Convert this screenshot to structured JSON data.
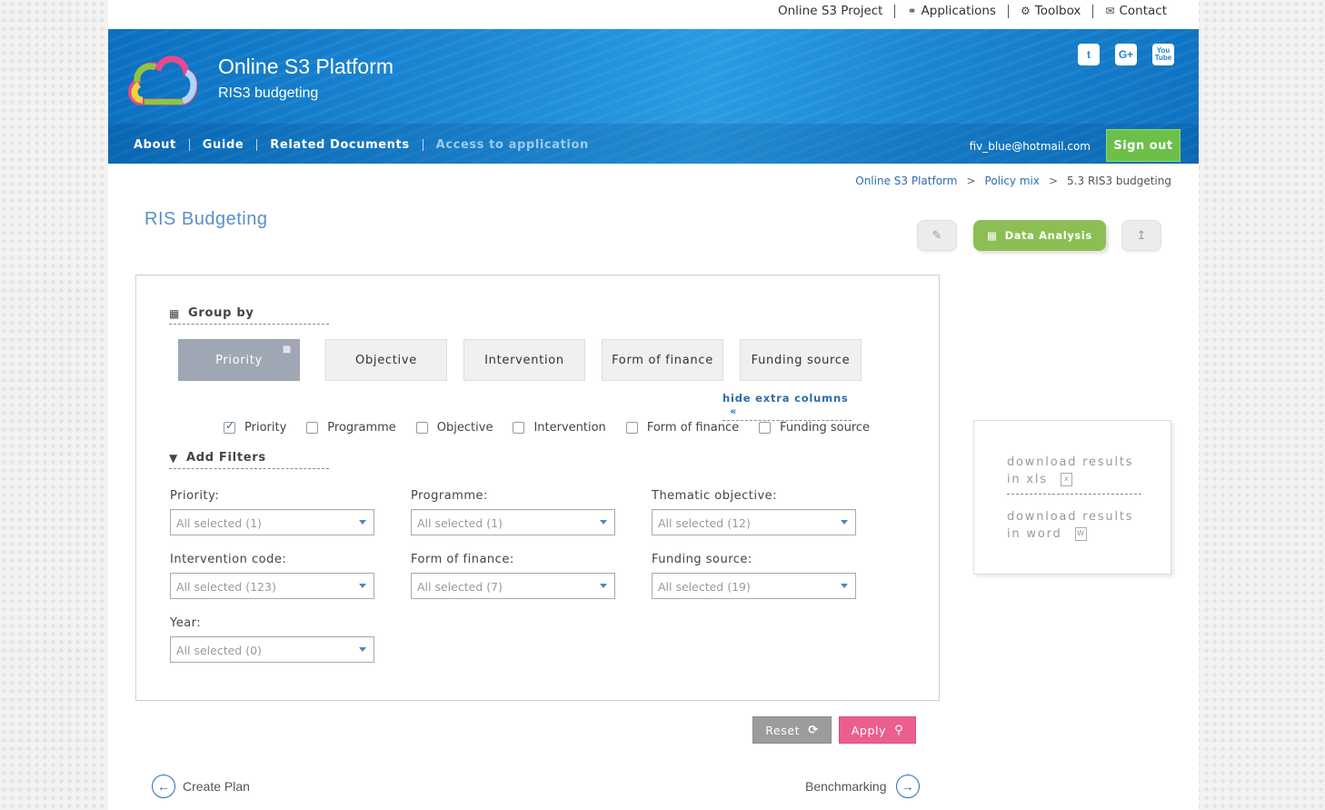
{
  "topnav": {
    "items": [
      {
        "label": "Online S3 Project",
        "icon": ""
      },
      {
        "label": "Applications",
        "icon": "bulb-icon"
      },
      {
        "label": "Toolbox",
        "icon": "gear-icon"
      },
      {
        "label": "Contact",
        "icon": "envelope-icon"
      }
    ]
  },
  "header": {
    "title": "Online S3 Platform",
    "subtitle": "RIS3 budgeting",
    "social": [
      "twitter-icon",
      "google-plus-icon",
      "youtube-icon"
    ],
    "nav": [
      {
        "label": "About"
      },
      {
        "label": "Guide"
      },
      {
        "label": "Related Documents"
      },
      {
        "label": "Access to application"
      }
    ],
    "user_email": "fiv_blue@hotmail.com",
    "signout_label": "Sign out"
  },
  "breadcrumb": {
    "items": [
      "Online S3 Platform",
      "Policy mix",
      "5.3 RIS3 budgeting"
    ],
    "separator": ">"
  },
  "page": {
    "title": "RIS Budgeting",
    "data_analysis_label": "Data Analysis"
  },
  "group_by": {
    "heading": "Group by",
    "tabs": [
      "Priority",
      "Objective",
      "Intervention",
      "Form of finance",
      "Funding source"
    ],
    "active": "Priority",
    "hide_extra_label": "hide extra columns",
    "hide_extra_arrow": "«",
    "columns": [
      {
        "label": "Priority",
        "checked": true
      },
      {
        "label": "Programme",
        "checked": false
      },
      {
        "label": "Objective",
        "checked": false
      },
      {
        "label": "Intervention",
        "checked": false
      },
      {
        "label": "Form of finance",
        "checked": false
      },
      {
        "label": "Funding source",
        "checked": false
      }
    ]
  },
  "filters": {
    "heading": "Add Filters",
    "items": [
      {
        "label": "Priority:",
        "value": "All selected (1)"
      },
      {
        "label": "Programme:",
        "value": "All selected (1)"
      },
      {
        "label": "Thematic objective:",
        "value": "All selected (12)"
      },
      {
        "label": "Intervention code:",
        "value": "All selected (123)"
      },
      {
        "label": "Form of finance:",
        "value": "All selected (7)"
      },
      {
        "label": "Funding source:",
        "value": "All selected (19)"
      },
      {
        "label": "Year:",
        "value": "All selected (0)"
      }
    ]
  },
  "actions": {
    "reset_label": "Reset",
    "apply_label": "Apply"
  },
  "downloads": {
    "xls_line1": "download results",
    "xls_line2": "in xls",
    "word_line1": "download results",
    "word_line2": "in word"
  },
  "pager": {
    "prev_label": "Create Plan",
    "next_label": "Benchmarking"
  },
  "colors": {
    "banner": "#1a86d2",
    "accent_green": "#8bbf53",
    "signout_green": "#6cc04a",
    "apply_pink": "#ea5f8c",
    "link_blue": "#2b6cb0"
  }
}
